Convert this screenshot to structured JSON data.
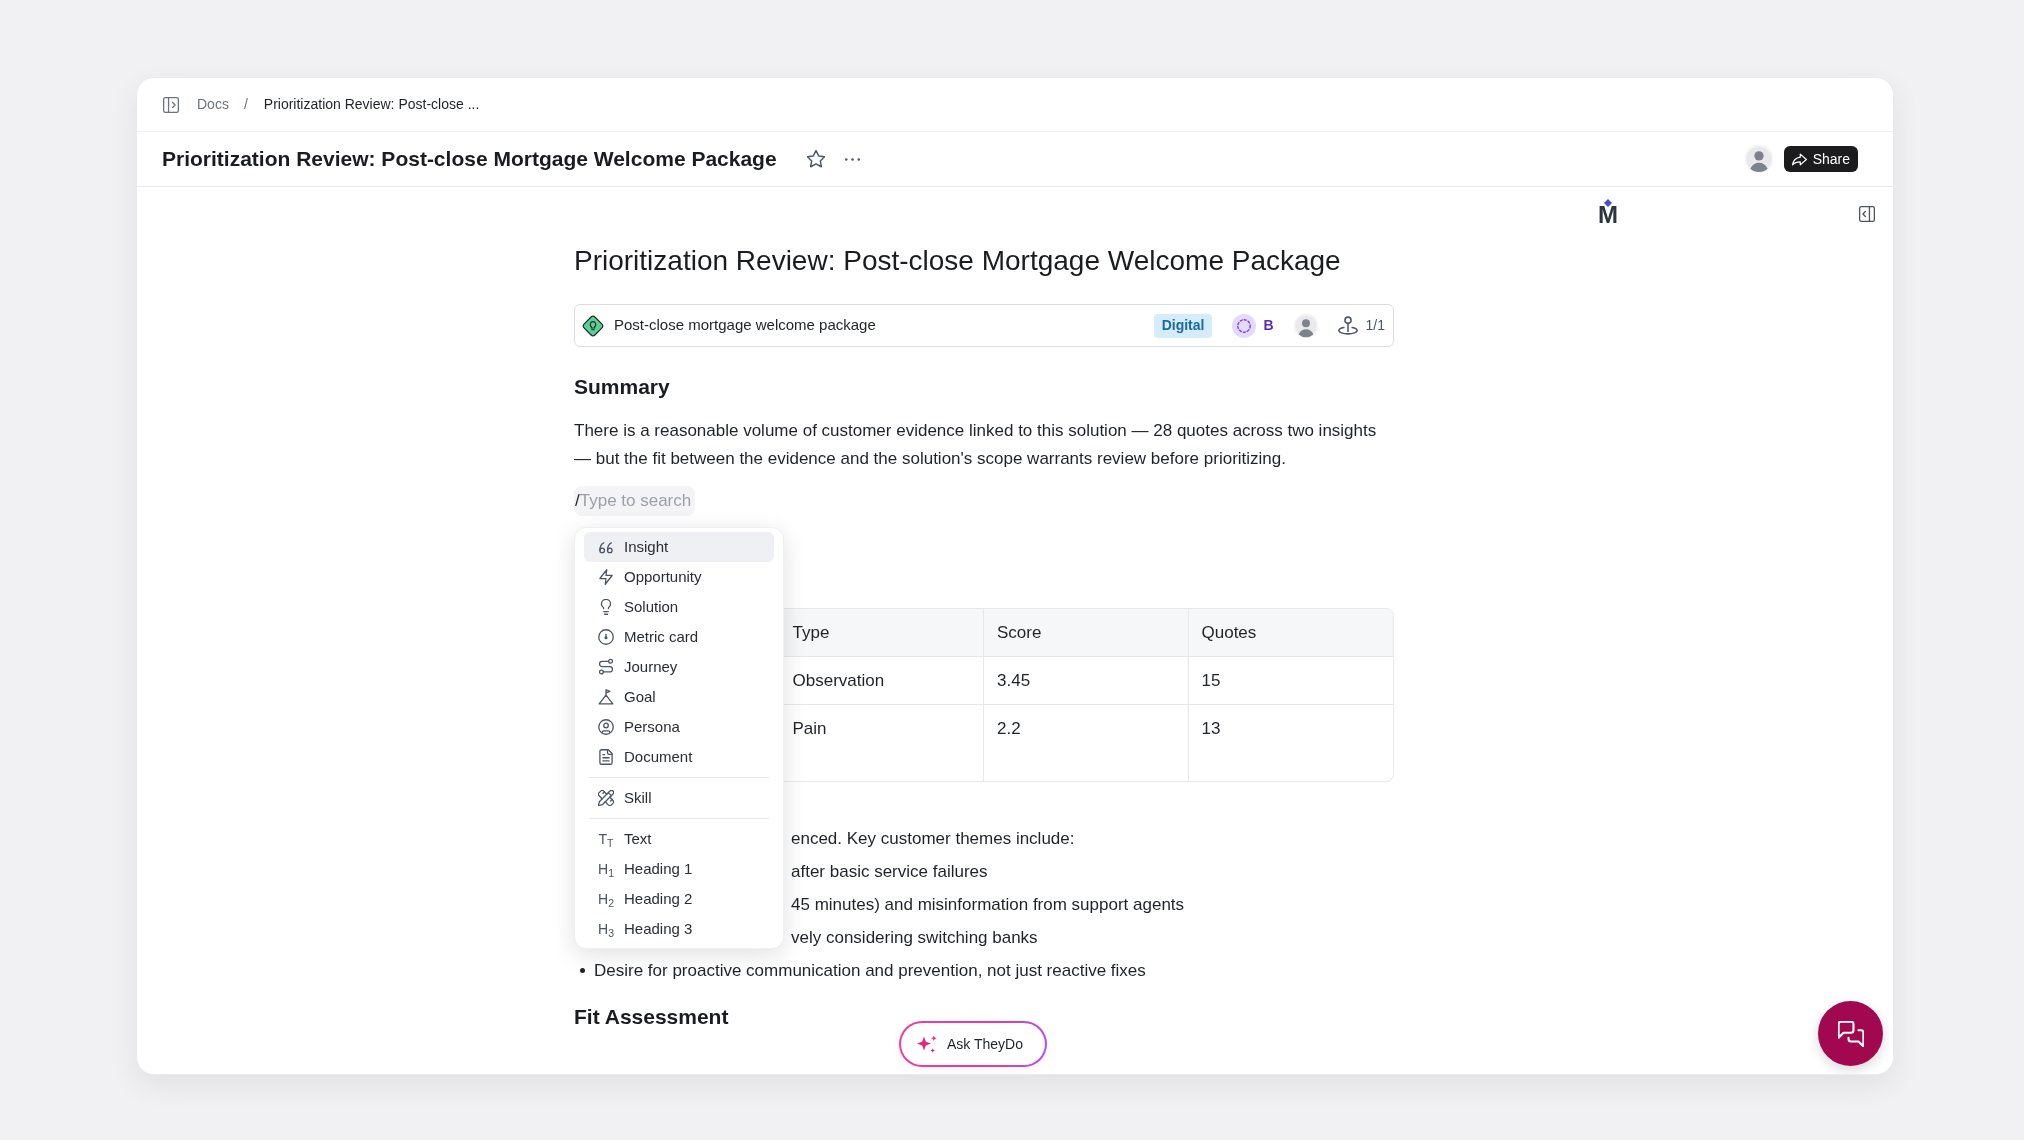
{
  "breadcrumbs": {
    "items": [
      {
        "label": "Docs"
      },
      {
        "label": "Prioritization Review: Post-close ..."
      }
    ],
    "separator": "/"
  },
  "header": {
    "title": "Prioritization Review: Post-close Mortgage Welcome Package",
    "share": "Share"
  },
  "logo": {
    "text": "M"
  },
  "doc": {
    "title": "Prioritization Review: Post-close Mortgage Welcome Package",
    "solution": {
      "name": "Post-close mortgage welcome package",
      "tag": "Digital",
      "owner_initial": "B",
      "journey_count": "1/1"
    },
    "summary": {
      "heading": "Summary",
      "text": "There is a reasonable volume of customer evidence linked to this solution — 28 quotes across two insights — but the fit between the evidence and the solution's scope warrants review before prioritizing."
    },
    "slash_command": {
      "value": "/",
      "placeholder": "Type to search"
    },
    "table": {
      "columns": [
        "Type",
        "Score",
        "Quotes"
      ],
      "rows": [
        [
          "Observation",
          "3.45",
          "15"
        ],
        [
          "Pain",
          "2.2",
          "13"
        ]
      ]
    },
    "lines": [
      {
        "kind": "paragraph",
        "text": "enced. Key customer themes include:"
      },
      {
        "kind": "item",
        "text": "after basic service failures"
      },
      {
        "kind": "item",
        "text": "45 minutes) and misinformation from support agents"
      },
      {
        "kind": "item",
        "text": "vely considering switching banks"
      },
      {
        "kind": "bullet",
        "text": "Desire for proactive communication and prevention, not just reactive fixes"
      }
    ],
    "fit_heading": "Fit Assessment"
  },
  "menu": {
    "groups": [
      {
        "items": [
          {
            "label": "Insight",
            "selected": true
          },
          {
            "label": "Opportunity",
            "selected": false
          },
          {
            "label": "Solution",
            "selected": false
          },
          {
            "label": "Metric card",
            "selected": false
          },
          {
            "label": "Journey",
            "selected": false
          },
          {
            "label": "Goal",
            "selected": false
          },
          {
            "label": "Persona",
            "selected": false
          },
          {
            "label": "Document",
            "selected": false
          }
        ]
      },
      {
        "items": [
          {
            "label": "Skill",
            "selected": false
          }
        ]
      },
      {
        "items": [
          {
            "label": "Text",
            "glyph": "T$_{T}$",
            "selected": false
          },
          {
            "label": "Heading 1",
            "glyph": "H$_{1}$",
            "selected": false
          },
          {
            "label": "Heading 2",
            "glyph": "H$_{2}$",
            "selected": false
          },
          {
            "label": "Heading 3",
            "glyph": "H$_{3}$",
            "selected": false
          }
        ]
      }
    ]
  },
  "ask_button": {
    "label": "Ask TheyDo"
  }
}
